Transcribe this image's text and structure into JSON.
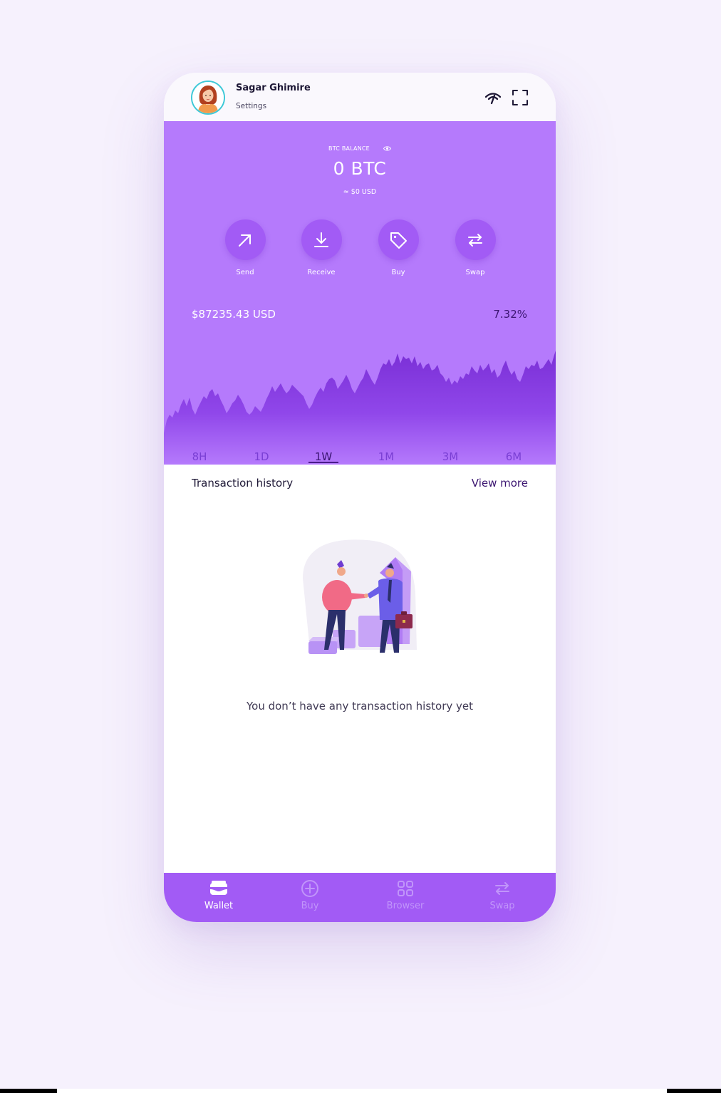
{
  "header": {
    "user_name": "Sagar Ghimire",
    "settings_label": "Settings",
    "icons": [
      "signal-icon",
      "scan-icon"
    ]
  },
  "balance": {
    "label": "BTC BALANCE",
    "amount": "0 BTC",
    "usd": "≈ $0 USD"
  },
  "actions": [
    {
      "label": "Send",
      "icon": "arrow-up-right-icon"
    },
    {
      "label": "Receive",
      "icon": "download-icon"
    },
    {
      "label": "Buy",
      "icon": "tag-icon"
    },
    {
      "label": "Swap",
      "icon": "swap-arrows-icon"
    }
  ],
  "market": {
    "price": "$87235.43 USD",
    "change": "7.32%"
  },
  "range_tabs": {
    "items": [
      "8H",
      "1D",
      "1W",
      "1M",
      "3M",
      "6M"
    ],
    "selected": "1W"
  },
  "history": {
    "title": "Transaction history",
    "view_more": "View more",
    "empty_message": "You don’t have any transaction history yet"
  },
  "nav": {
    "items": [
      {
        "label": "Wallet",
        "icon": "wallet-icon"
      },
      {
        "label": "Buy",
        "icon": "plus-circle-icon"
      },
      {
        "label": "Browser",
        "icon": "grid-icon"
      },
      {
        "label": "Swap",
        "icon": "swap-arrows-icon"
      }
    ],
    "selected": "Wallet"
  },
  "colors": {
    "panel": "#b57afc",
    "action_button": "#a25bf5",
    "nav_bar": "#a25bf5",
    "chart_fill_top": "#7a2fd6",
    "dark_text": "#3a1470"
  }
}
